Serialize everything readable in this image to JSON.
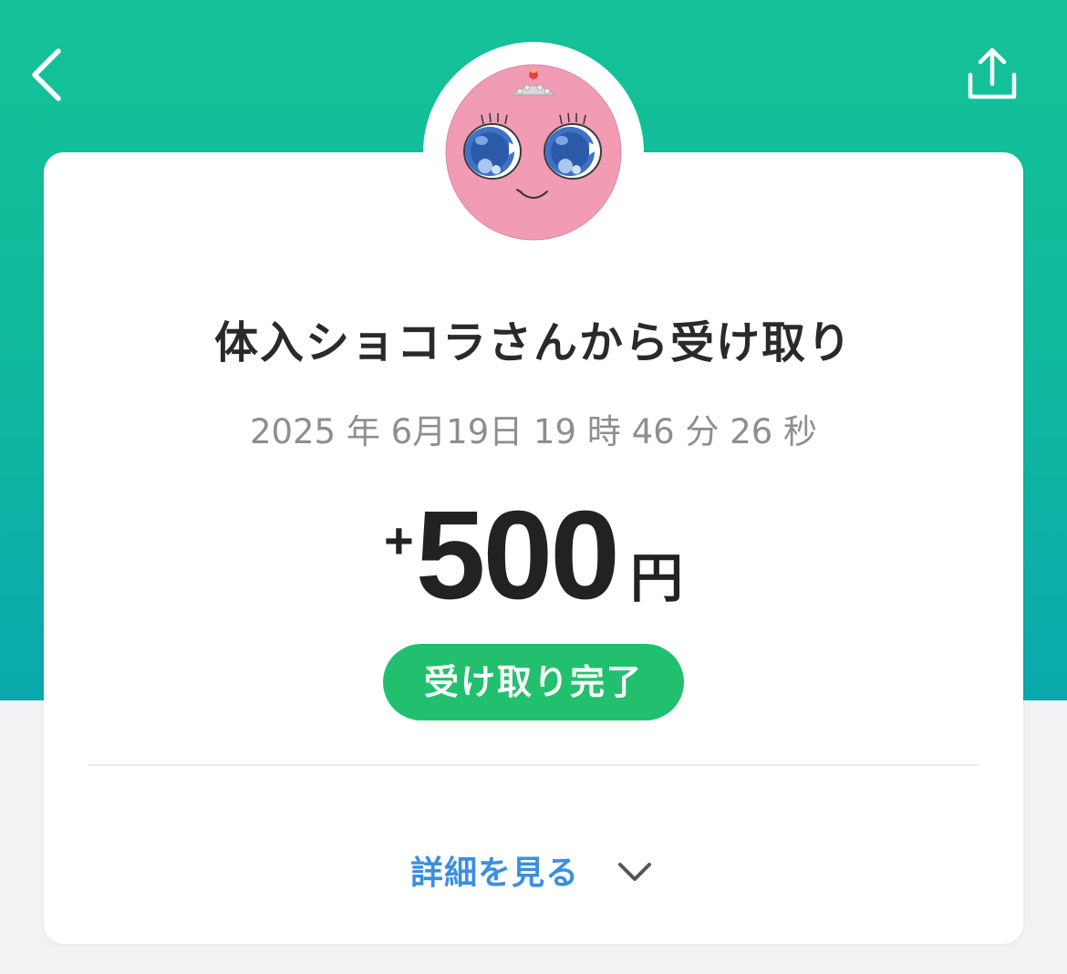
{
  "nav": {
    "back_icon": "chevron-left-icon",
    "share_icon": "share-icon"
  },
  "transaction": {
    "title": "体入ショコラさんから受け取り",
    "datetime": "2025 年 6月19日 19 時 46 分 26 秒",
    "amount_sign": "+",
    "amount_value": "500",
    "amount_unit": "円",
    "status": "受け取り完了"
  },
  "details": {
    "label": "詳細を見る",
    "icon": "chevron-down-icon"
  },
  "colors": {
    "header_green": "#14c297",
    "status_green": "#22c06e",
    "link_blue": "#3a8fe0",
    "avatar_pink": "#f19bb4"
  }
}
